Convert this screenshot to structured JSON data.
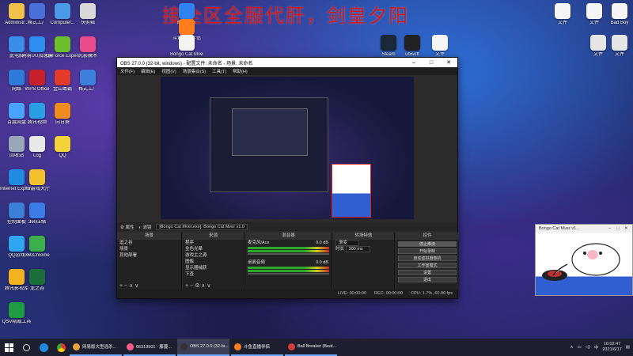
{
  "watermark": "接全区全服代肝，剑皇夕阳",
  "desktop_left": [
    {
      "label": "Administr...",
      "color": "#f0c24b"
    },
    {
      "label": "此电脑",
      "color": "#3a8ee6"
    },
    {
      "label": "网络",
      "color": "#2f79d8"
    },
    {
      "label": "百度网盘",
      "color": "#4aa3ff"
    },
    {
      "label": "回收站",
      "color": "#9aa7b8"
    },
    {
      "label": "Internet Explorer",
      "color": "#1f8be0"
    },
    {
      "label": "控制面板",
      "color": "#3c7fd8"
    },
    {
      "label": "QQ游戏",
      "color": "#2fa7f0"
    },
    {
      "label": "腾讯影视库",
      "color": "#f2b321"
    },
    {
      "label": "QSV精裁工具",
      "color": "#1e9c43"
    }
  ],
  "desktop_col2": [
    {
      "label": "格式工厂",
      "color": "#4a6fd8"
    },
    {
      "label": "网易UU加速器",
      "color": "#2d8ef0"
    },
    {
      "label": "WPS Office",
      "color": "#c8202a"
    },
    {
      "label": "腾讯视频",
      "color": "#2b9fe6"
    },
    {
      "label": "Log",
      "color": "#e8e8e8"
    },
    {
      "label": "YY游戏大厅",
      "color": "#f2c12e"
    },
    {
      "label": "360压缩",
      "color": "#3b7be6"
    },
    {
      "label": "360Chrome",
      "color": "#3bb04a"
    },
    {
      "label": "龙之谷",
      "color": "#1b6e3a"
    }
  ],
  "desktop_col3": [
    {
      "label": "Computer...",
      "color": "#4b9ae8"
    },
    {
      "label": "GeForce Experience",
      "color": "#6cbf2a"
    },
    {
      "label": "金山毒霸",
      "color": "#e23b2c"
    },
    {
      "label": "向日葵",
      "color": "#f08c1e"
    },
    {
      "label": "QQ",
      "color": "#f3d33a"
    }
  ],
  "desktop_col4": [
    {
      "label": "快剪辑",
      "color": "#d8d8d8"
    },
    {
      "label": "光影魔术",
      "color": "#e84c8b"
    },
    {
      "label": "格式工厂",
      "color": "#3e7fdb"
    }
  ],
  "desktop_top_right": [
    {
      "label": "酷我音乐",
      "color": "#2f82f0"
    },
    {
      "label": "斗鱼直播伴侣",
      "color": "#ff7d1e"
    },
    {
      "label": "Bongo Cat Mver",
      "color": "#f3f3f3"
    }
  ],
  "desktop_right": [
    {
      "label": "Steam",
      "color": "#1b2838"
    },
    {
      "label": "ubisoft",
      "color": "#222"
    },
    {
      "label": "文件",
      "color": "#f5f5f5"
    },
    {
      "label": "文件",
      "color": "#f5f5f5"
    },
    {
      "label": "文件",
      "color": "#f5f5f5"
    },
    {
      "label": "Bad Boy",
      "color": "#f5f5f5"
    },
    {
      "label": "文件",
      "color": "#e5e5e5"
    },
    {
      "label": "文件",
      "color": "#e5e5e5"
    }
  ],
  "obs": {
    "title": "OBS 27.0.0 (32-bit, windows) - 配置文件: 未命名 - 场景: 未命名",
    "menu": [
      "文件(F)",
      "编辑(E)",
      "视图(V)",
      "工具(T)",
      "帮助(H)",
      "场景集合(S)"
    ],
    "source_bar": {
      "label_props": "属性",
      "label_filters": "滤镜",
      "window": "[Bongo Cat Mver.exe]: Bongo Cat Mver v1.0"
    },
    "docks": {
      "scenes": {
        "title": "场景",
        "items": [
          "逗之谷",
          "场景",
          "其他部署"
        ]
      },
      "sources": {
        "title": "来源",
        "items": [
          "程序",
          "全色光晕",
          "游戏主之源",
          "图像",
          "显示器捕获",
          "下查",
          "窗口捕获"
        ]
      },
      "mixer": {
        "title": "混音器",
        "tracks": [
          {
            "name": "麦克风/Aux",
            "db": "0.0 dB"
          },
          {
            "name": "桌面音频",
            "db": "0.0 dB"
          }
        ]
      },
      "transitions": {
        "title": "转场特效",
        "type": "渐变",
        "duration_label": "时长",
        "duration": "300 ms"
      },
      "controls": {
        "title": "控件",
        "buttons": [
          "停止推流",
          "开始录制",
          "启动虚拟摄像机",
          "工作室模式",
          "设置",
          "退出"
        ]
      }
    },
    "status": {
      "live": "LIVE: 00:00:00",
      "rec": "REC: 00:00:00",
      "cpu": "CPU: 1.7%, 60.00 fps"
    }
  },
  "cam_window": {
    "title": "Bongo Cat Mver v1..."
  },
  "taskbar": {
    "tasks": [
      {
        "label": "网易版大型逃杀...",
        "color": "#e8a33a"
      },
      {
        "label": "66319501 - 藤蔓...",
        "color": "#ff5c8a"
      },
      {
        "label": "OBS 27.0.0 (32-bi...",
        "color": "#333"
      },
      {
        "label": "斗鱼直播伴侣",
        "color": "#ff7d1e"
      },
      {
        "label": "Ball Breaker (Beat...",
        "color": "#d43b3b"
      }
    ],
    "time": "16:02:47",
    "date": "2021/6/17"
  }
}
